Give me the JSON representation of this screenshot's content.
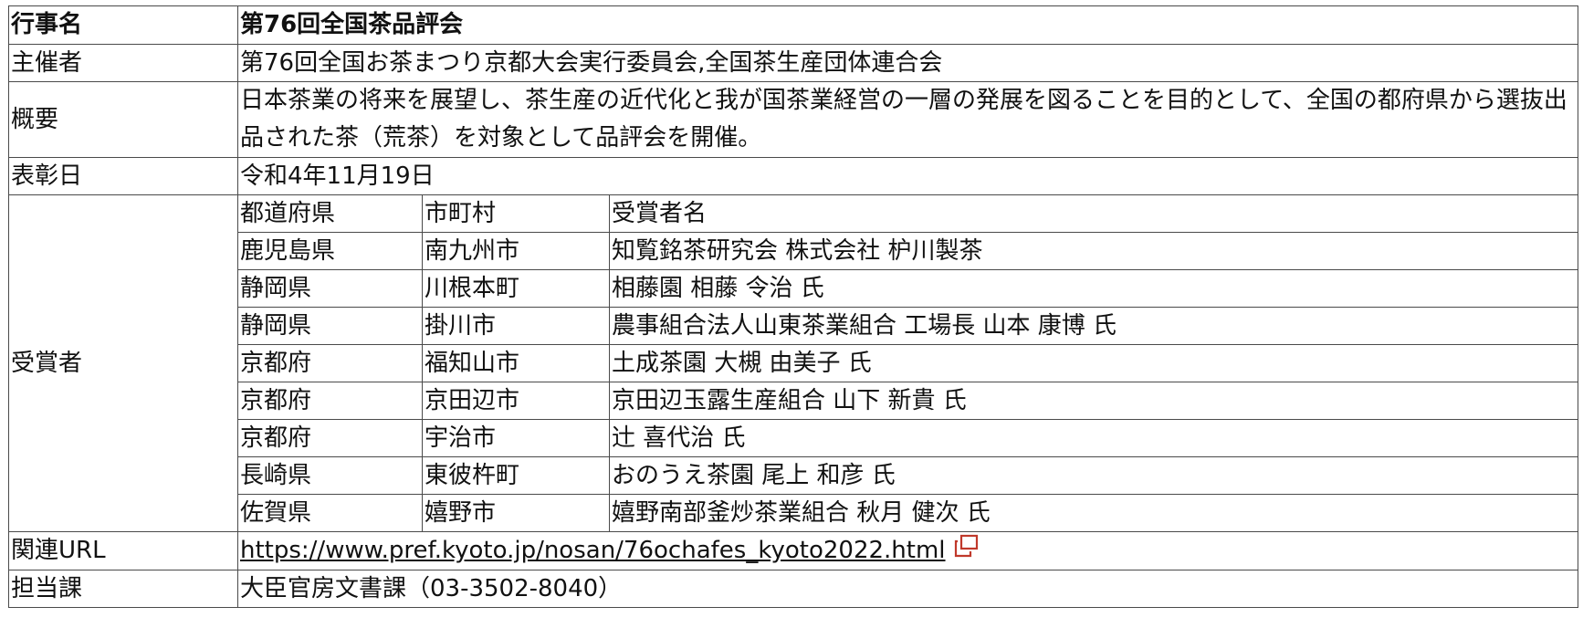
{
  "event": {
    "label": "行事名",
    "value": "第76回全国茶品評会"
  },
  "organizer": {
    "label": "主催者",
    "value": "第76回全国お茶まつり京都大会実行委員会,全国茶生産団体連合会"
  },
  "summary": {
    "label": "概要",
    "value": "日本茶業の将来を展望し、茶生産の近代化と我が国茶業経営の一層の発展を図ることを目的として、全国の都府県から選抜出品された茶（荒茶）を対象として品評会を開催。"
  },
  "award_date": {
    "label": "表彰日",
    "value": "令和4年11月19日"
  },
  "winners": {
    "label": "受賞者",
    "columns": [
      "都道府県",
      "市町村",
      "受賞者名"
    ],
    "rows": [
      [
        "鹿児島県",
        "南九州市",
        "知覧銘茶研究会 株式会社 枦川製茶"
      ],
      [
        "静岡県",
        "川根本町",
        "相藤園 相藤 令治 氏"
      ],
      [
        "静岡県",
        "掛川市",
        "農事組合法人山東茶業組合 工場長 山本 康博 氏"
      ],
      [
        "京都府",
        "福知山市",
        "土成茶園 大槻 由美子 氏"
      ],
      [
        "京都府",
        "京田辺市",
        "京田辺玉露生産組合 山下 新貴 氏"
      ],
      [
        "京都府",
        "宇治市",
        "辻 喜代治 氏"
      ],
      [
        "長崎県",
        "東彼杵町",
        "おのうえ茶園 尾上 和彦 氏"
      ],
      [
        "佐賀県",
        "嬉野市",
        "嬉野南部釜炒茶業組合 秋月 健次 氏"
      ]
    ]
  },
  "related_url": {
    "label": "関連URL",
    "value": "https://www.pref.kyoto.jp/nosan/76ochafes_kyoto2022.html",
    "icon": "external-link-icon",
    "icon_color": "#c0392b"
  },
  "department": {
    "label": "担当課",
    "value": "大臣官房文書課（03-3502-8040）"
  }
}
